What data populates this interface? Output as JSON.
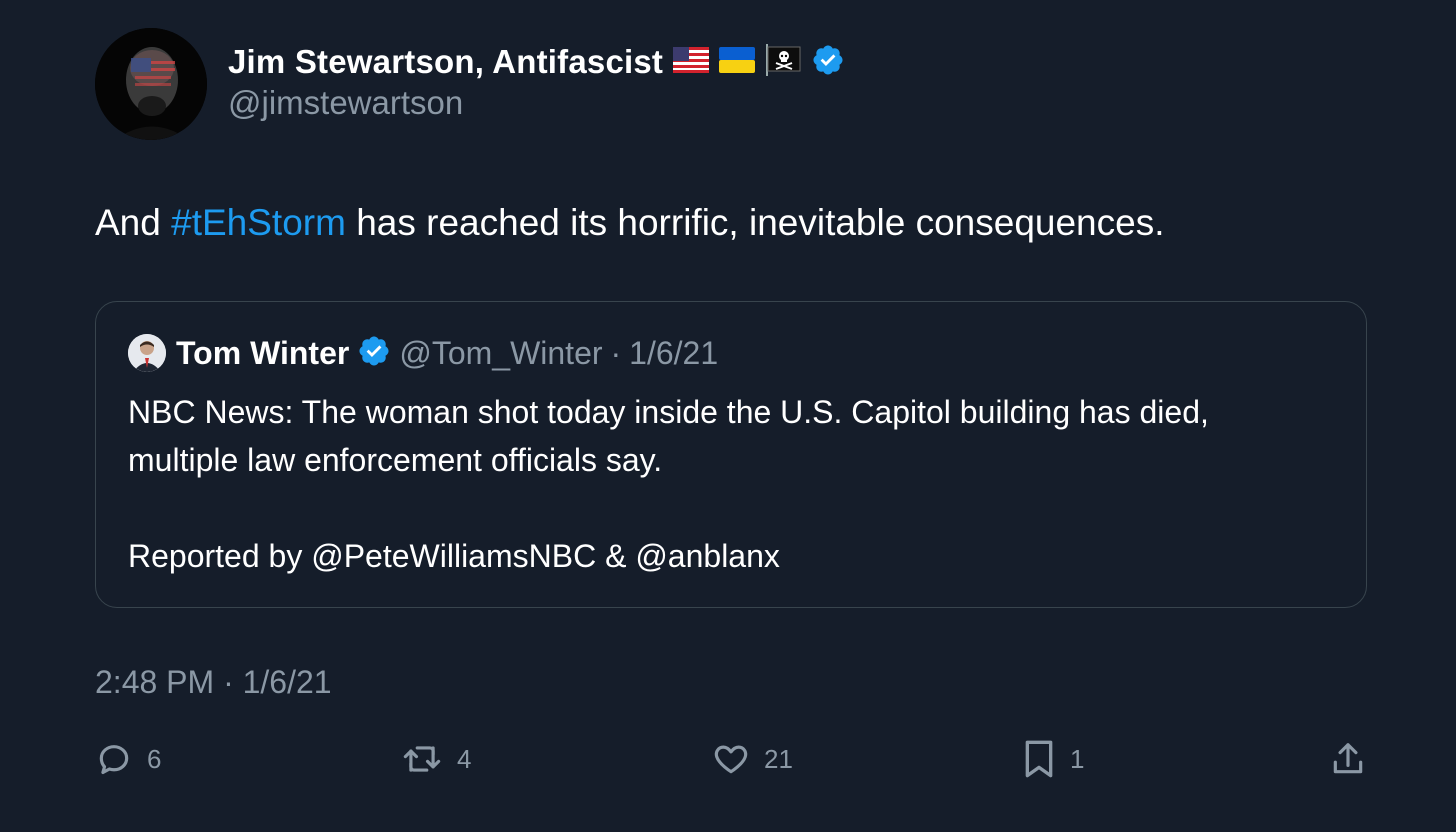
{
  "author": {
    "display_name": "Jim Stewartson, Antifascist",
    "handle": "@jimstewartson",
    "flags": [
      "us-flag-icon",
      "ukraine-flag-icon",
      "pirate-flag-icon"
    ],
    "verified": true
  },
  "tweet": {
    "text_before": "And ",
    "hashtag": "#tEhStorm",
    "text_after": " has reached its horrific, inevitable consequences."
  },
  "quoted_tweet": {
    "display_name": "Tom Winter",
    "handle": "@Tom_Winter",
    "separator": "·",
    "date": "1/6/21",
    "verified": true,
    "line1": "NBC News: The woman shot today inside the U.S. Capitol building has died,",
    "line2": "multiple law enforcement officials say.",
    "line3": "Reported by @PeteWilliamsNBC & @anblanx"
  },
  "timestamp": "2:48 PM · 1/6/21",
  "actions": {
    "replies": "6",
    "retweets": "4",
    "likes": "21",
    "bookmarks": "1"
  },
  "colors": {
    "background": "#151d2a",
    "accent": "#1d9bf0",
    "muted": "#8b98a5",
    "border": "#38444d"
  }
}
